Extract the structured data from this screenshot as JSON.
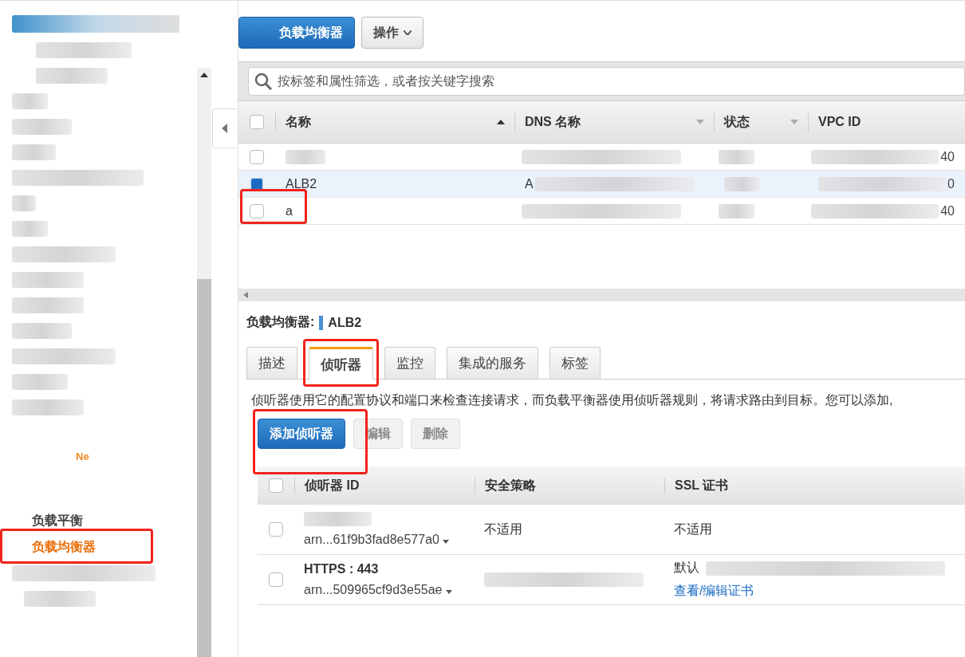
{
  "sidebar": {
    "items": [
      {
        "label": "Ne",
        "kind": "fragment"
      },
      {
        "label": "负载平衡",
        "kind": "heading"
      },
      {
        "label": "负载均衡器",
        "kind": "link",
        "selected": true
      }
    ]
  },
  "toolbar": {
    "create_button": "负载均衡器",
    "actions_button": "操作"
  },
  "search": {
    "placeholder": "按标签和属性筛选，或者按关键字搜索"
  },
  "table": {
    "select_all_checked": false,
    "columns": [
      {
        "label": "名称",
        "kind": "sorted"
      },
      {
        "label": "DNS 名称",
        "kind": "menu"
      },
      {
        "label": "状态",
        "kind": "menu"
      },
      {
        "label": "VPC ID",
        "kind": "plain"
      }
    ],
    "rows": [
      {
        "selected": false,
        "vpc_tail": "40"
      },
      {
        "selected": true,
        "name": "ALB2",
        "dns_head": "A",
        "vpc_tail": "0"
      },
      {
        "selected": false,
        "name": "a",
        "vpc_tail": "40"
      }
    ]
  },
  "detail": {
    "label": "负载均衡器:",
    "name": "ALB2",
    "tabs": [
      {
        "label": "描述",
        "selected": false
      },
      {
        "label": "侦听器",
        "selected": true
      },
      {
        "label": "监控",
        "selected": false
      },
      {
        "label": "集成的服务",
        "selected": false
      },
      {
        "label": "标签",
        "selected": false
      }
    ],
    "description": "侦听器使用它的配置协议和端口来检查连接请求，而负载平衡器使用侦听器规则，将请求路由到目标。您可以添加,",
    "buttons": [
      {
        "label": "添加侦听器",
        "disabled": false
      },
      {
        "label": "编辑",
        "disabled": true
      },
      {
        "label": "删除",
        "disabled": true
      }
    ],
    "listeners": {
      "select_all_checked": false,
      "columns": [
        "侦听器 ID",
        "安全策略",
        "SSL 证书"
      ],
      "rows": [
        {
          "checked": false,
          "arn": "arn...61f9b3fad8e577a0",
          "policy": "不适用",
          "certificate": "不适用"
        },
        {
          "checked": false,
          "protocol": "HTTPS : 443",
          "arn": "arn...509965cf9d3e55ae",
          "certificate": "默认",
          "cert_link": "查看/编辑证书"
        }
      ]
    }
  }
}
